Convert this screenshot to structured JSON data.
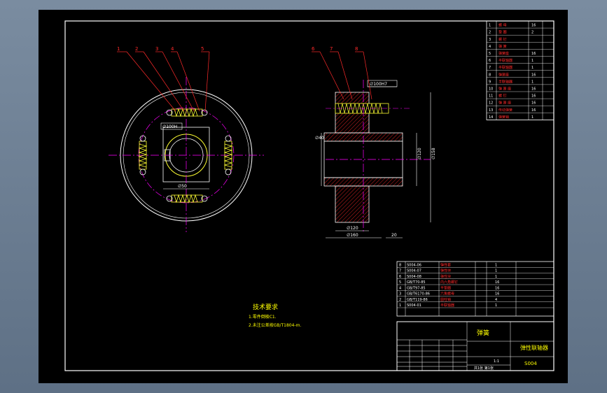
{
  "colors": {
    "frame": "#ff2a2a",
    "hatch": "#d02020",
    "centerline": "#ff00ff",
    "dimension": "#ffffff",
    "detail": "#ffff33",
    "text_yellow": "#ffff00",
    "text_white": "#ffffff"
  },
  "callouts": {
    "left_view": [
      "1",
      "2",
      "3",
      "4",
      "5"
    ],
    "section_view": [
      "6",
      "7",
      "8"
    ]
  },
  "left_view": {
    "dims": {
      "d1": "∅100H",
      "d2": "∅50"
    }
  },
  "section_view": {
    "dims": {
      "top": "∅100H7",
      "left": "∅40",
      "right_a": "∅120",
      "right_b": "∅158",
      "bottom_a": "∅120",
      "bottom_b": "∅160",
      "bottom_c": "20"
    }
  },
  "tech_requirements": {
    "title": "技术要求",
    "items": [
      "1.零件倒棱C1.",
      "2.未注公差按GB/T1804-m."
    ]
  },
  "title_block": {
    "name": "弹簧",
    "drawing_title": "弹性联轴器",
    "drawing_no": "S004",
    "scale": "1:1",
    "sheet": "共1张 第1张"
  },
  "parts_list_top": {
    "rows": [
      [
        "1",
        "螺 母",
        "16"
      ],
      [
        "2",
        "垫 圈",
        "2"
      ],
      [
        "3",
        "螺 钉",
        ""
      ],
      [
        "4",
        "弹 簧",
        ""
      ],
      [
        "5",
        "弹簧座",
        "16"
      ],
      [
        "6",
        "半联轴器",
        "1"
      ],
      [
        "7",
        "半联轴器",
        "1"
      ],
      [
        "8",
        "弹簧座",
        "16"
      ],
      [
        "9",
        "半联轴器",
        "1"
      ],
      [
        "10",
        "弹 簧 座",
        "16"
      ],
      [
        "11",
        "螺 钉",
        "16"
      ],
      [
        "12",
        "弹 簧 座",
        "16"
      ],
      [
        "13",
        "传动弹簧",
        "16"
      ],
      [
        "14",
        "弹簧销",
        "1"
      ]
    ]
  },
  "parts_list_bottom": {
    "rows": [
      [
        "S004-06",
        "弹性套",
        "",
        "1"
      ],
      [
        "S004-07",
        "弹性块",
        "",
        "1"
      ],
      [
        "S004-08",
        "弹性块",
        "",
        "1"
      ],
      [
        "GB/T70-85",
        "内六角螺钉",
        "",
        "16"
      ],
      [
        "GB/T97-85",
        "平垫圈",
        "",
        "16"
      ],
      [
        "GB/T6170-86",
        "六角螺母",
        "",
        "16"
      ],
      [
        "GB/T119-86",
        "圆柱销",
        "",
        "4"
      ],
      [
        "S004-01",
        "半联轴器",
        "",
        "1"
      ]
    ]
  }
}
